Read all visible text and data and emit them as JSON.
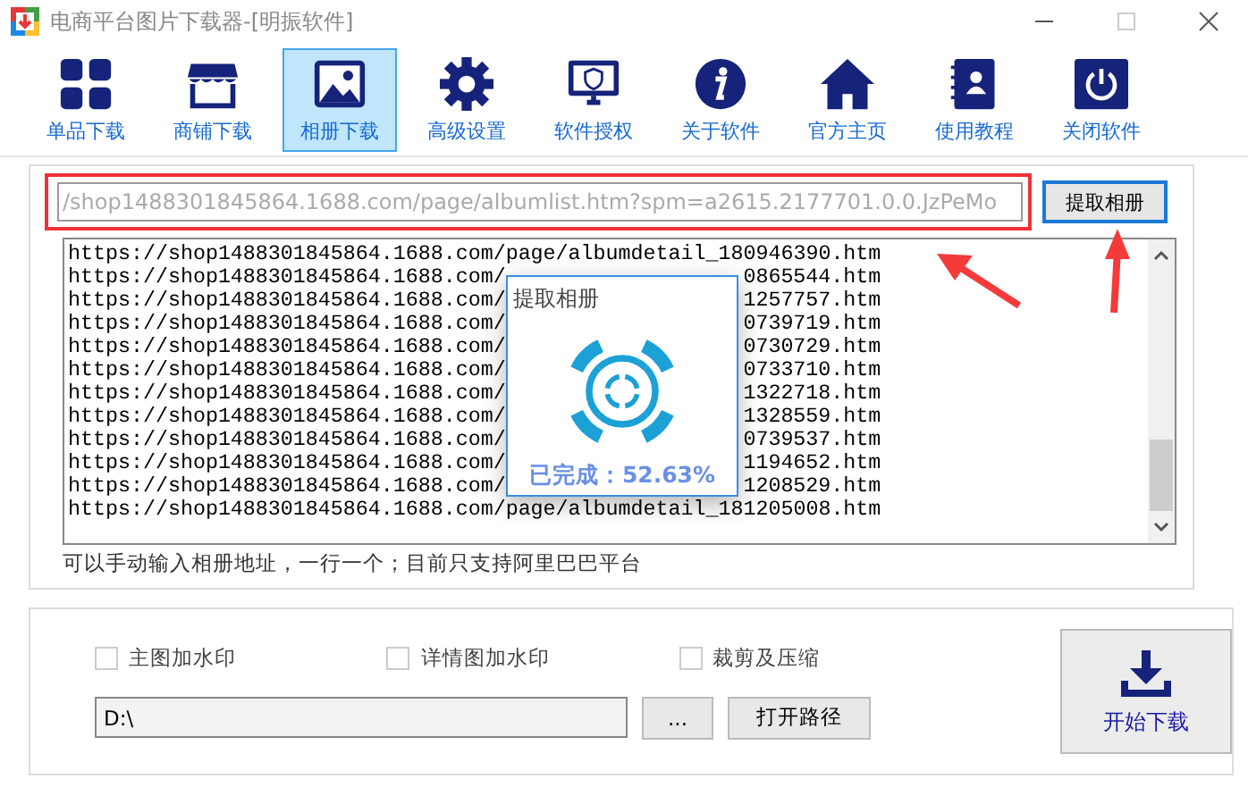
{
  "window": {
    "title": "电商平台图片下载器-[明振软件]"
  },
  "toolbar": [
    {
      "label": "单品下载",
      "kind": "grid",
      "selected": false
    },
    {
      "label": "商铺下载",
      "kind": "store",
      "selected": false
    },
    {
      "label": "相册下载",
      "kind": "image",
      "selected": true
    },
    {
      "label": "高级设置",
      "kind": "gear",
      "selected": false
    },
    {
      "label": "软件授权",
      "kind": "monitor",
      "selected": false
    },
    {
      "label": "关于软件",
      "kind": "info",
      "selected": false
    },
    {
      "label": "官方主页",
      "kind": "home",
      "selected": false
    },
    {
      "label": "使用教程",
      "kind": "book",
      "selected": false
    },
    {
      "label": "关闭软件",
      "kind": "power",
      "selected": false
    }
  ],
  "url_field": {
    "value": "/shop1488301845864.1688.com/page/albumlist.htm?spm=a2615.2177701.0.0.JzPeMo"
  },
  "extract_button": "提取相册",
  "album_list": [
    {
      "left": "https://shop1488301845864.1688.com/page/albumdetail_180946390.htm"
    },
    {
      "left": "https://shop1488301845864.1688.com/",
      "right": "0865544.htm"
    },
    {
      "left": "https://shop1488301845864.1688.com/",
      "right": "1257757.htm"
    },
    {
      "left": "https://shop1488301845864.1688.com/",
      "right": "0739719.htm"
    },
    {
      "left": "https://shop1488301845864.1688.com/",
      "right": "0730729.htm"
    },
    {
      "left": "https://shop1488301845864.1688.com/",
      "right": "0733710.htm"
    },
    {
      "left": "https://shop1488301845864.1688.com/",
      "right": "1322718.htm"
    },
    {
      "left": "https://shop1488301845864.1688.com/",
      "right": "1328559.htm"
    },
    {
      "left": "https://shop1488301845864.1688.com/",
      "right": "0739537.htm"
    },
    {
      "left": "https://shop1488301845864.1688.com/",
      "right": "1194652.htm"
    },
    {
      "left": "https://shop1488301845864.1688.com/",
      "right": "1208529.htm"
    },
    {
      "left": "https://shop1488301845864.1688.com/page/albumdetail_181205008.htm"
    }
  ],
  "hint": "可以手动输入相册地址，一行一个；目前只支持阿里巴巴平台",
  "progress_dialog": {
    "title": "提取相册",
    "status": "已完成：52.63%"
  },
  "options": [
    {
      "label": "主图加水印",
      "checked": false
    },
    {
      "label": "详情图加水印",
      "checked": false
    },
    {
      "label": "裁剪及压缩",
      "checked": false
    }
  ],
  "path_field": {
    "value": "D:\\"
  },
  "browse_button": "...",
  "open_path_button": "打开路径",
  "start_button": "开始下载"
}
